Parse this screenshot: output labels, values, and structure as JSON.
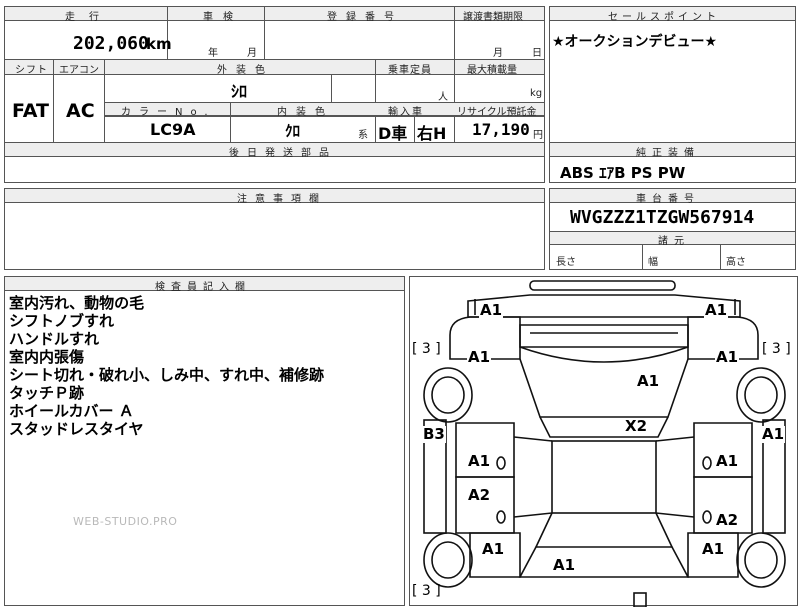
{
  "top": {
    "mileage_header": "走行",
    "inspection_header": "車検",
    "registration_header": "登録番号",
    "transfer_deadline_header": "譲渡書類期限",
    "sales_points_header": "セールスポイント",
    "mileage_value": "202,060",
    "mileage_unit": "km",
    "year_label": "年",
    "month_label": "月",
    "deadline_month_label": "月",
    "deadline_day_label": "日",
    "sales_point_text": "★オークションデビュー★"
  },
  "spec": {
    "shift_header": "シフト",
    "aircon_header": "エアコン",
    "exterior_color_header": "外装色",
    "capacity_header": "乗車定員",
    "max_load_header": "最大積載量",
    "shift_value": "FAT",
    "aircon_value": "AC",
    "exterior_color_value": "ｼﾛ",
    "capacity_unit": "人",
    "max_load_unit": "kg",
    "color_no_header": "カラーNo.",
    "interior_color_header": "内装色",
    "import_header": "輸入車",
    "recycle_header": "リサイクル預託金",
    "color_no_value": "LC9A",
    "interior_color_value": "ｸﾛ",
    "interior_color_suffix": "系",
    "import_value_1": "D車",
    "import_value_2": "右H",
    "recycle_value": "17,190",
    "recycle_unit": "円",
    "later_parts_header": "後日発送部品"
  },
  "equipment": {
    "header": "純正装備",
    "value": "ABS ｴｱB PS PW"
  },
  "notes_section": {
    "header": "注意事項欄"
  },
  "chassis": {
    "header": "車台番号",
    "value": "WVGZZZ1TZGW567914",
    "dims_header": "諸元",
    "length_label": "長さ",
    "width_label": "幅",
    "height_label": "高さ"
  },
  "inspector": {
    "header": "検査員記入欄",
    "lines": [
      "室内汚れ、動物の毛",
      "シフトノブすれ",
      "ハンドルすれ",
      "室内内張傷",
      "シート切れ・破れ小、しみ中、すれ中、補修跡",
      "タッチＰ跡",
      "ホイールカバー Ａ",
      "スタッドレスタイヤ"
    ],
    "watermark": "WEB-STUDIO.PRO"
  },
  "damage_map": {
    "marks": [
      "A1",
      "A1",
      "A1",
      "A1",
      "A1",
      "X2",
      "B3",
      "A1",
      "A1",
      "A1",
      "A2",
      "A2",
      "A1",
      "A1",
      "A1"
    ],
    "tire_brackets": [
      "[ 3 ]",
      "[ 3 ]",
      "[ 3 ]"
    ]
  }
}
